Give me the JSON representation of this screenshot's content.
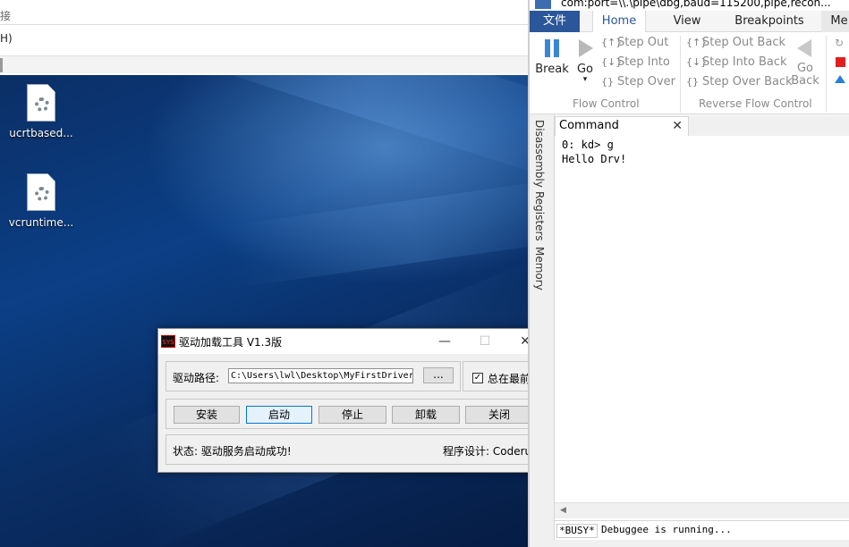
{
  "explorer": {
    "address_fragment": "接",
    "menu_fragment": "H)"
  },
  "desktop": {
    "icons": [
      {
        "label": "ucrtbased..."
      },
      {
        "label": "vcruntime..."
      }
    ]
  },
  "driver_tool": {
    "sys_badge": "SYS",
    "title": "驱动加载工具 V1.3版",
    "window_controls": {
      "minimize": "—",
      "maximize": "☐",
      "close": "✕"
    },
    "path_label": "驱动路径:",
    "path_value": "C:\\Users\\lwl\\Desktop\\MyFirstDriver",
    "browse_label": "...",
    "checkbox_mark": "✓",
    "topmost_label": "总在最前",
    "buttons": {
      "install": "安装",
      "start": "启动",
      "stop": "停止",
      "uninstall": "卸载",
      "close": "关闭"
    },
    "status_text": "状态: 驱动服务启动成功!",
    "author_text": "程序设计: Coderu"
  },
  "windbg": {
    "title": "com:port=\\\\.\\pipe\\dbg,baud=115200,pipe,recon...",
    "tabs": {
      "file": "文件",
      "home": "Home",
      "view": "View",
      "breakpoints": "Breakpoints",
      "more": "Me"
    },
    "ribbon": {
      "break_label": "Break",
      "go_label": "Go",
      "go_dropdown": "▾",
      "step_out": "Step Out",
      "step_into": "Step Into",
      "step_over": "Step Over",
      "step_out_back": "Step Out Back",
      "step_into_back": "Step Into Back",
      "step_over_back": "Step Over Back",
      "go_back_line1": "Go",
      "go_back_line2": "Back",
      "flow_control": "Flow Control",
      "reverse_flow_control": "Reverse Flow Control"
    },
    "side_tabs": {
      "disassembly": "Disassembly",
      "registers": "Registers",
      "memory": "Memory"
    },
    "command_tab": "Command",
    "command_close": "✕",
    "output_lines": [
      "0: kd> g",
      "Hello Drv!"
    ],
    "status_busy": "*BUSY*",
    "status_message": "Debuggee is running..."
  }
}
